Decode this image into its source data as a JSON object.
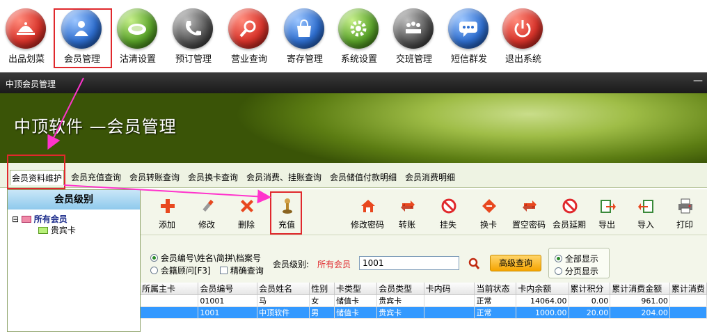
{
  "toolbar": {
    "items": [
      {
        "label": "出品划菜",
        "icon": "cloche-icon",
        "color": "#d9342b"
      },
      {
        "label": "会员管理",
        "icon": "user-icon",
        "color": "#2f6fd0"
      },
      {
        "label": "沽清设置",
        "icon": "plate-icon",
        "color": "#5aa32a"
      },
      {
        "label": "预订管理",
        "icon": "phone-icon",
        "color": "#555555"
      },
      {
        "label": "营业查询",
        "icon": "magnifier-icon",
        "color": "#d9342b"
      },
      {
        "label": "寄存管理",
        "icon": "bag-icon",
        "color": "#2f6fd0"
      },
      {
        "label": "系统设置",
        "icon": "gear-icon",
        "color": "#5aa32a"
      },
      {
        "label": "交班管理",
        "icon": "meeting-icon",
        "color": "#555555"
      },
      {
        "label": "短信群发",
        "icon": "sms-icon",
        "color": "#2f6fd0"
      },
      {
        "label": "退出系统",
        "icon": "power-icon",
        "color": "#d9342b"
      }
    ]
  },
  "titlebar": {
    "title": "中顶会员管理",
    "min": "—"
  },
  "banner": {
    "title": "中顶软件 —会员管理"
  },
  "tabs": [
    "会员资料维护",
    "会员充值查询",
    "会员转账查询",
    "会员换卡查询",
    "会员消费、挂账查询",
    "会员储值付款明细",
    "会员消费明细"
  ],
  "left_panel": {
    "title": "会员级别",
    "tree_root": "所有会员",
    "tree_child": "贵宾卡",
    "collapse": "⊟"
  },
  "actions": [
    {
      "label": "添加",
      "icon": "add-icon"
    },
    {
      "label": "修改",
      "icon": "edit-icon"
    },
    {
      "label": "删除",
      "icon": "delete-icon"
    },
    {
      "label": "充值",
      "icon": "recharge-icon"
    },
    {
      "label": "修改密码",
      "icon": "house-key-icon"
    },
    {
      "label": "转账",
      "icon": "transfer-icon"
    },
    {
      "label": "挂失",
      "icon": "ban-icon"
    },
    {
      "label": "换卡",
      "icon": "swap-icon"
    },
    {
      "label": "置空密码",
      "icon": "clear-password-icon"
    },
    {
      "label": "会员延期",
      "icon": "extend-icon"
    },
    {
      "label": "导出",
      "icon": "export-icon"
    },
    {
      "label": "导入",
      "icon": "import-icon"
    },
    {
      "label": "打印",
      "icon": "printer-icon"
    }
  ],
  "search": {
    "opt1": "会员编号\\姓名\\简拼\\档案号",
    "opt2": "会籍顾问[F3]",
    "exact": "精确查询",
    "level_label": "会员级别:",
    "level_value": "所有会员",
    "input_value": "1001",
    "advanced": "高级查询",
    "show_all": "全部显示",
    "paged": "分页显示"
  },
  "grid": {
    "headers": [
      "所属主卡",
      "会员编号",
      "会员姓名",
      "性别",
      "卡类型",
      "会员类型",
      "卡内码",
      "当前状态",
      "卡内余额",
      "累计积分",
      "累计消费金额",
      "累计消费"
    ],
    "rows": [
      [
        "",
        "01001",
        "马",
        "女",
        "储值卡",
        "贵宾卡",
        "",
        "正常",
        "14064.00",
        "0.00",
        "961.00",
        ""
      ],
      [
        "",
        "1001",
        "中顶软件",
        "男",
        "储值卡",
        "贵宾卡",
        "",
        "正常",
        "1000.00",
        "20.00",
        "204.00",
        ""
      ]
    ]
  },
  "colors": {
    "highlight": "#e0282c",
    "arrow": "#ff33cc",
    "selected_row": "#3399ff"
  }
}
